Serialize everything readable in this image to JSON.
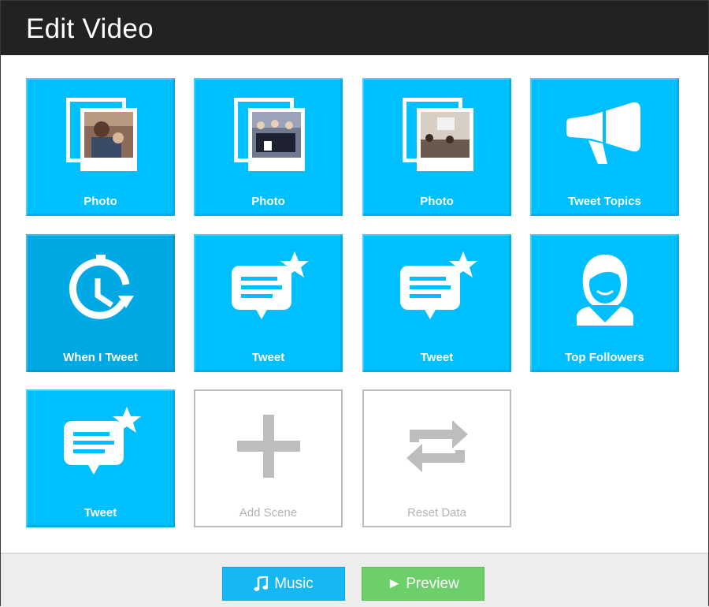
{
  "header": {
    "title": "Edit Video"
  },
  "tiles": [
    {
      "label": "Photo",
      "icon": "photo-stack-icon"
    },
    {
      "label": "Photo",
      "icon": "photo-stack-icon"
    },
    {
      "label": "Photo",
      "icon": "photo-stack-icon"
    },
    {
      "label": "Tweet Topics",
      "icon": "megaphone-icon"
    },
    {
      "label": "When I Tweet",
      "icon": "clock-refresh-icon"
    },
    {
      "label": "Tweet",
      "icon": "tweet-star-icon"
    },
    {
      "label": "Tweet",
      "icon": "tweet-star-icon"
    },
    {
      "label": "Top Followers",
      "icon": "person-icon"
    },
    {
      "label": "Tweet",
      "icon": "tweet-star-icon"
    },
    {
      "label": "Add Scene",
      "icon": "plus-icon"
    },
    {
      "label": "Reset Data",
      "icon": "swap-arrows-icon"
    }
  ],
  "footer": {
    "music_label": "Music",
    "music_icon": "music-note-icon",
    "preview_label": "► Preview"
  },
  "colors": {
    "header_bg": "#222222",
    "tile_blue": "#00bfff",
    "tile_blue_dark": "#00a9e3",
    "music_button": "#15b8f2",
    "preview_button": "#6ccf6a",
    "empty_icon_gray": "#bdbdbd"
  }
}
